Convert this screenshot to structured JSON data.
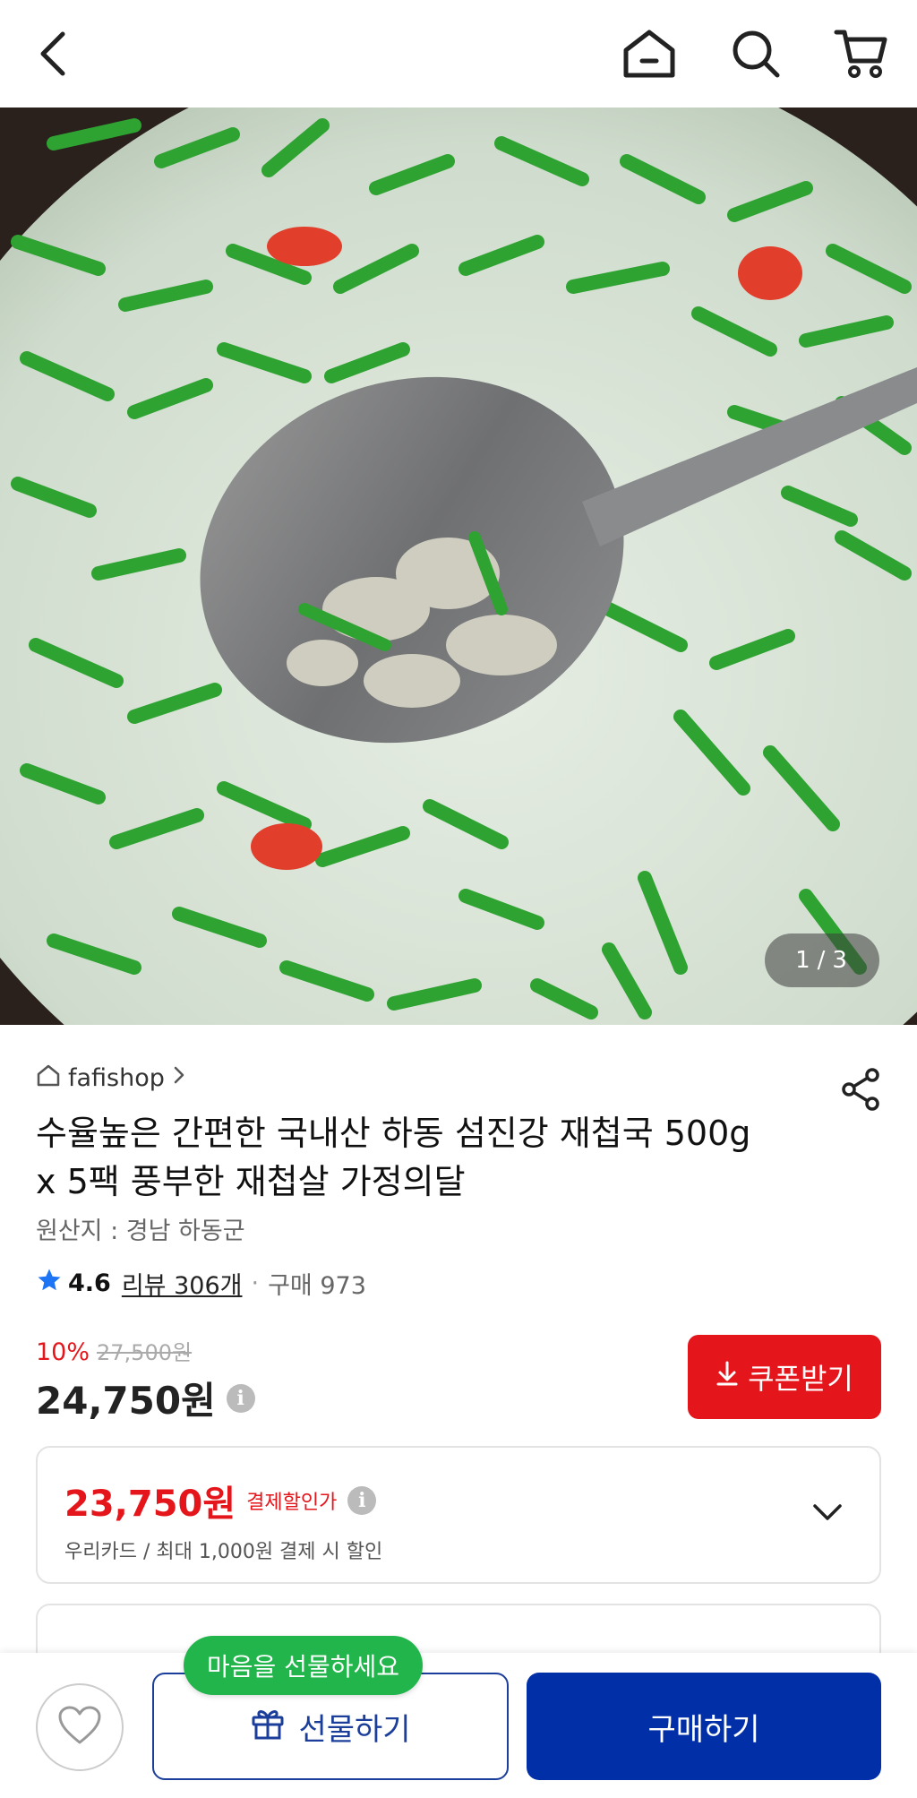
{
  "header": {
    "back_icon": "back-arrow-icon",
    "home_icon": "home-icon",
    "search_icon": "search-icon",
    "cart_icon": "cart-icon"
  },
  "gallery": {
    "current": "1",
    "separator": "/",
    "total": "3"
  },
  "product": {
    "seller": "fafishop",
    "title_line1": "수율높은 간편한 국내산 하동 섬진강 재첩국 500g",
    "title_line2": "x 5팩 풍부한 재첩살 가정의달",
    "origin": "원산지 : 경남 하동군",
    "rating": "4.6",
    "review": "리뷰 306개",
    "purchase": "구매 973",
    "discount_rate": "10%",
    "original_price": "27,500원",
    "price": "24,750원"
  },
  "coupon": {
    "label": "쿠폰받기"
  },
  "payment_discount": {
    "amount": "23,750원",
    "label": "결제할인가",
    "description": "우리카드 / 최대 1,000원 결제 시 할인"
  },
  "bottom": {
    "tooltip": "마음을 선물하세요",
    "gift_label": "선물하기",
    "buy_label": "구매하기"
  },
  "colors": {
    "accent_red": "#e4151b",
    "accent_blue": "#002fa7",
    "gift_green": "#22b54c"
  }
}
